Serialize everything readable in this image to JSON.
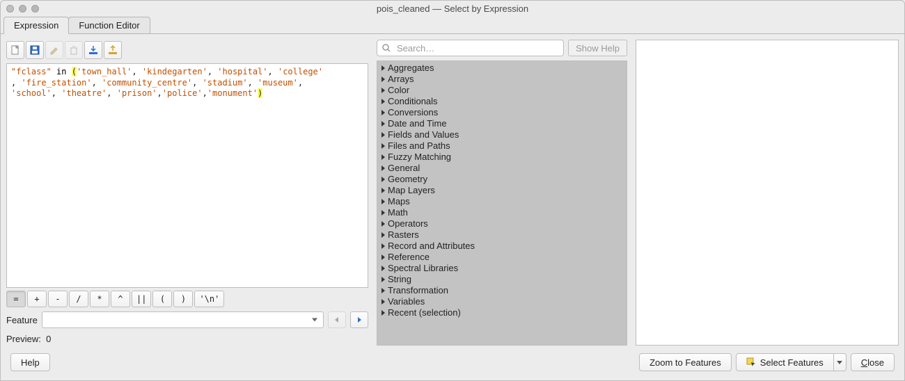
{
  "window": {
    "title": "pois_cleaned — Select by Expression"
  },
  "tabs": [
    {
      "label": "Expression",
      "active": true
    },
    {
      "label": "Function Editor",
      "active": false
    }
  ],
  "toolbar_icons": [
    "new-file-icon",
    "save-icon",
    "edit-icon",
    "delete-icon",
    "import-icon",
    "export-icon"
  ],
  "expression_tokens": [
    {
      "t": "\"fclass\"",
      "c": "field"
    },
    {
      "t": " ",
      "c": ""
    },
    {
      "t": "in",
      "c": "inop"
    },
    {
      "t": " ",
      "c": ""
    },
    {
      "t": "(",
      "c": "hl"
    },
    {
      "t": "'town_hall'",
      "c": "str"
    },
    {
      "t": ", ",
      "c": ""
    },
    {
      "t": "'kindegarten'",
      "c": "str"
    },
    {
      "t": ", ",
      "c": ""
    },
    {
      "t": "'hospital'",
      "c": "str"
    },
    {
      "t": ", ",
      "c": ""
    },
    {
      "t": "'college'",
      "c": "str"
    },
    {
      "t": "\n, ",
      "c": ""
    },
    {
      "t": "'fire_station'",
      "c": "str"
    },
    {
      "t": ", ",
      "c": ""
    },
    {
      "t": "'community_centre'",
      "c": "str"
    },
    {
      "t": ", ",
      "c": ""
    },
    {
      "t": "'stadium'",
      "c": "str"
    },
    {
      "t": ", ",
      "c": ""
    },
    {
      "t": "'museum'",
      "c": "str"
    },
    {
      "t": ",\n",
      "c": ""
    },
    {
      "t": "'school'",
      "c": "str"
    },
    {
      "t": ", ",
      "c": ""
    },
    {
      "t": "'theatre'",
      "c": "str"
    },
    {
      "t": ", ",
      "c": ""
    },
    {
      "t": "'prison'",
      "c": "str"
    },
    {
      "t": ",",
      "c": ""
    },
    {
      "t": "'police'",
      "c": "str"
    },
    {
      "t": ",",
      "c": ""
    },
    {
      "t": "'monument'",
      "c": "str"
    },
    {
      "t": ")",
      "c": "hl"
    }
  ],
  "operators": [
    {
      "label": "=",
      "pressed": true
    },
    {
      "label": "+"
    },
    {
      "label": "-"
    },
    {
      "label": "/"
    },
    {
      "label": "*"
    },
    {
      "label": "^"
    },
    {
      "label": "||"
    },
    {
      "label": "("
    },
    {
      "label": ")"
    },
    {
      "label": "'\\n'"
    }
  ],
  "feature": {
    "label": "Feature",
    "value": ""
  },
  "preview": {
    "label": "Preview:",
    "value": "0"
  },
  "search": {
    "placeholder": "Search…"
  },
  "buttons": {
    "show_help": "Show Help",
    "help": "Help",
    "zoom": "Zoom to Features",
    "select": "Select Features",
    "close_u": "C",
    "close_rest": "lose"
  },
  "categories": [
    "Aggregates",
    "Arrays",
    "Color",
    "Conditionals",
    "Conversions",
    "Date and Time",
    "Fields and Values",
    "Files and Paths",
    "Fuzzy Matching",
    "General",
    "Geometry",
    "Map Layers",
    "Maps",
    "Math",
    "Operators",
    "Rasters",
    "Record and Attributes",
    "Reference",
    "Spectral Libraries",
    "String",
    "Transformation",
    "Variables",
    "Recent (selection)"
  ]
}
